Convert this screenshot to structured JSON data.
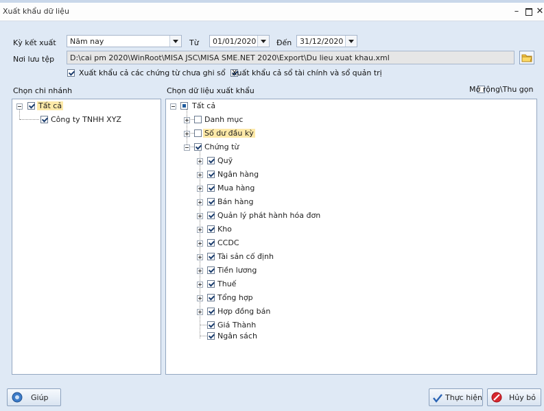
{
  "window": {
    "title": "Xuất khẩu dữ liệu"
  },
  "form": {
    "period_label": "Kỳ kết xuất",
    "period_value": "Năm nay",
    "from_label": "Từ",
    "from_value": "01/01/2020",
    "to_label": "Đến",
    "to_value": "31/12/2020",
    "save_label": "Nơi lưu tệp",
    "save_path": "D:\\cai pm 2020\\WinRoot\\MISA JSC\\MISA SME.NET 2020\\Export\\Du lieu xuat khau.xml",
    "opt_unposted": "Xuất khẩu cả các chứng từ chưa ghi sổ",
    "opt_unposted_checked": true,
    "opt_books": "Xuất khẩu cả sổ tài chính và sổ quản trị",
    "opt_books_checked": true
  },
  "branch_panel": {
    "title": "Chọn chi nhánh",
    "root": "Tất cả",
    "children": [
      "Công ty TNHH XYZ"
    ]
  },
  "data_panel": {
    "title": "Chọn dữ liệu xuất khẩu",
    "expand_toggle": "Mở rộng\\Thu gọn",
    "root": "Tất cả",
    "items": [
      {
        "label": "Danh mục",
        "checked": false,
        "highlight": false
      },
      {
        "label": "Số dư đầu kỳ",
        "checked": false,
        "highlight": true
      },
      {
        "label": "Chứng từ",
        "checked": true,
        "highlight": false
      }
    ],
    "documents": [
      "Quỹ",
      "Ngân hàng",
      "Mua hàng",
      "Bán hàng",
      "Quản lý phát hành hóa đơn",
      "Kho",
      "CCDC",
      "Tài sản cố định",
      "Tiền lương",
      "Thuế",
      "Tổng hợp",
      "Hợp đồng bán"
    ],
    "documents_leaf": [
      "Giá Thành",
      "Ngân sách"
    ]
  },
  "buttons": {
    "help": "Giúp",
    "execute": "Thực hiện",
    "cancel": "Hủy bỏ"
  }
}
